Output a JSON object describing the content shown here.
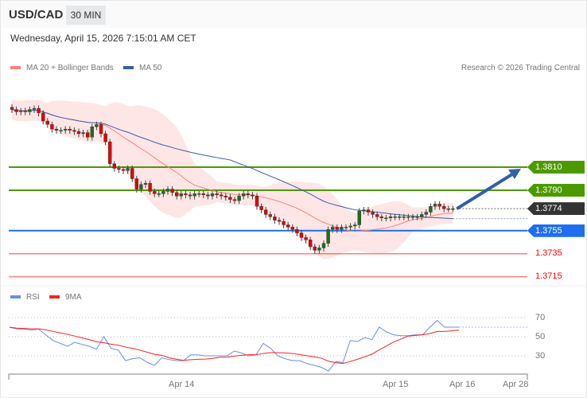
{
  "header": {
    "symbol": "USD/CAD",
    "timeframe": "30 MIN",
    "datetime": "Wednesday, April 15, 2026 7:15:01 AM CET"
  },
  "legend": {
    "ma20": "MA 20 + Bollinger Bands",
    "ma50": "MA 50",
    "credit": "Research © 2026 Trading Central"
  },
  "rsi_legend": {
    "rsi": "RSI",
    "ma": "9MA"
  },
  "colors": {
    "up": "#1e6b1e",
    "down": "#e00000",
    "ma20": "#ff8080",
    "ma50": "#3b5ea8",
    "band": "#ffe0e0",
    "resistance": "#4c9a00",
    "current": "#333333",
    "pivot": "#1e6ef0",
    "support": "#ff0000",
    "rsi": "#6b8fe6",
    "rsi_ma": "#ff2020"
  },
  "levels": [
    {
      "label": "1.3810",
      "value": 1.381,
      "type": "resistance"
    },
    {
      "label": "1.3790",
      "value": 1.379,
      "type": "resistance"
    },
    {
      "label": "1.3774",
      "value": 1.3774,
      "type": "current"
    },
    {
      "label": "1.3755",
      "value": 1.3755,
      "type": "pivot"
    },
    {
      "label": "1.3735",
      "value": 1.3735,
      "type": "support"
    },
    {
      "label": "1.3715",
      "value": 1.3715,
      "type": "support"
    }
  ],
  "chart_data": [
    {
      "type": "candlestick",
      "title": "USD/CAD 30 MIN",
      "ylim": [
        1.37,
        1.388
      ],
      "closes": [
        1.386,
        1.3858,
        1.3859,
        1.3858,
        1.386,
        1.3861,
        1.3857,
        1.385,
        1.3847,
        1.3843,
        1.3842,
        1.3842,
        1.3843,
        1.3842,
        1.3841,
        1.3839,
        1.384,
        1.3836,
        1.3845,
        1.3847,
        1.3839,
        1.3832,
        1.3813,
        1.3809,
        1.3808,
        1.3807,
        1.3809,
        1.38,
        1.3791,
        1.3795,
        1.3796,
        1.3789,
        1.3787,
        1.3787,
        1.3789,
        1.3791,
        1.3788,
        1.3785,
        1.3787,
        1.3786,
        1.3785,
        1.3787,
        1.3787,
        1.3786,
        1.3785,
        1.3787,
        1.3786,
        1.3785,
        1.3784,
        1.3782,
        1.3781,
        1.3785,
        1.3787,
        1.3786,
        1.3785,
        1.3776,
        1.3773,
        1.3769,
        1.3767,
        1.3764,
        1.3763,
        1.376,
        1.3758,
        1.3756,
        1.3753,
        1.3749,
        1.3747,
        1.3741,
        1.3738,
        1.374,
        1.3744,
        1.3756,
        1.3758,
        1.3756,
        1.3758,
        1.3758,
        1.3759,
        1.376,
        1.3772,
        1.3773,
        1.3771,
        1.3769,
        1.3767,
        1.3766,
        1.3766,
        1.3767,
        1.3767,
        1.3767,
        1.3767,
        1.3767,
        1.3767,
        1.3767,
        1.3769,
        1.3771,
        1.3776,
        1.3778,
        1.3776,
        1.3774,
        1.3774,
        1.3774
      ],
      "forecast": {
        "from": 1.3774,
        "to": 1.381,
        "direction": "up"
      }
    },
    {
      "type": "line",
      "title": "RSI",
      "ylim": [
        10,
        80
      ],
      "yticks": [
        70,
        50,
        30
      ],
      "rsi": [
        60,
        58,
        58,
        57,
        58,
        52,
        46,
        43,
        40,
        44,
        42,
        40,
        37,
        50,
        38,
        36,
        25,
        27,
        28,
        23,
        20,
        28,
        26,
        25,
        25,
        31,
        31,
        30,
        30,
        30,
        30,
        35,
        33,
        30,
        31,
        43,
        38,
        30,
        27,
        25,
        25,
        22,
        20,
        18,
        14,
        24,
        23,
        46,
        45,
        49,
        47,
        60,
        55,
        52,
        51,
        51,
        52,
        52,
        60,
        67,
        60,
        60,
        60
      ],
      "xticks": [
        "Apr 14",
        "Apr 15",
        "Apr 16",
        "Apr 28"
      ]
    }
  ]
}
